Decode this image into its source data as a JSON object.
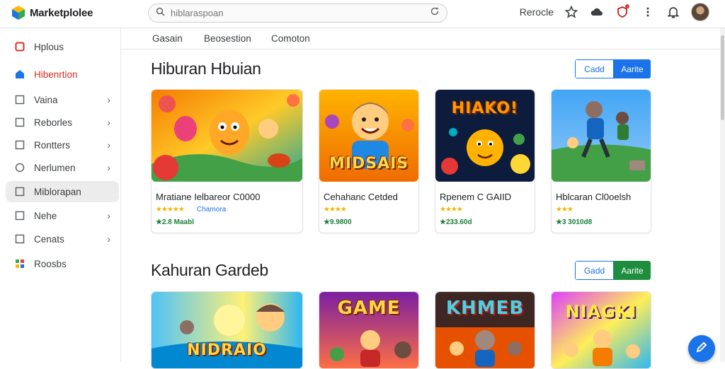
{
  "app": {
    "name": "Marketplolee"
  },
  "search": {
    "placeholder": "hiblaraspoan"
  },
  "header": {
    "link": "Rerocle",
    "icons": [
      "star-icon",
      "cloud-icon",
      "shield-icon",
      "more-icon",
      "bell-icon",
      "avatar"
    ]
  },
  "sidebar": {
    "items": [
      {
        "label": "Hplous",
        "icon": "box-icon",
        "chevron": false,
        "state": "normal"
      },
      {
        "label": "Hibenrtion",
        "icon": "home-icon",
        "chevron": false,
        "state": "active"
      },
      {
        "label": "Vaina",
        "icon": "square-icon",
        "chevron": true,
        "state": "normal"
      },
      {
        "label": "Reborles",
        "icon": "square-icon",
        "chevron": true,
        "state": "normal"
      },
      {
        "label": "Rontters",
        "icon": "square-icon",
        "chevron": true,
        "state": "normal"
      },
      {
        "label": "Nerlumen",
        "icon": "circle-icon",
        "chevron": true,
        "state": "normal"
      },
      {
        "label": "Miblorapan",
        "icon": "square-icon",
        "chevron": false,
        "state": "selected"
      },
      {
        "label": "Nehe",
        "icon": "square-icon",
        "chevron": true,
        "state": "normal"
      },
      {
        "label": "Cenats",
        "icon": "square-icon",
        "chevron": true,
        "state": "normal"
      },
      {
        "label": "Roosbs",
        "icon": "grid-icon",
        "chevron": false,
        "state": "normal"
      }
    ]
  },
  "tabs": [
    "Gasain",
    "Beosestion",
    "Comoton"
  ],
  "sections": [
    {
      "title": "Hiburan Hbuian",
      "btn_left": "Cadd",
      "btn_right": "Aarite",
      "btn_color": "#1a73e8",
      "cards": [
        {
          "title": "Mratiane Ielbareor C0000",
          "stars": "★★★★★",
          "sub": "Chamora",
          "price": "★2.8 Maabl",
          "thumb_text": ""
        },
        {
          "title": "Cehahanc Cetded",
          "stars": "★★★★",
          "sub": "",
          "price": "★9.9800",
          "thumb_text": "MIDSAIS"
        },
        {
          "title": "Rpenem C GAIID",
          "stars": "★★★★",
          "sub": "",
          "price": "★233.60d",
          "thumb_text": "HIAKO!"
        },
        {
          "title": "Hblcaran Cl0oelsh",
          "stars": "★★★",
          "sub": "",
          "price": "★3 3010d8",
          "thumb_text": ""
        }
      ]
    },
    {
      "title": "Kahuran Gardeb",
      "btn_left": "Gadd",
      "btn_right": "Aarite",
      "btn_color": "#1e8e3e",
      "cards": [
        {
          "thumb_text": "NIDRAIO"
        },
        {
          "thumb_text": "GAME"
        },
        {
          "thumb_text": "KHMEB"
        },
        {
          "thumb_text": "NIAGKI"
        }
      ]
    }
  ],
  "colors": {
    "accent": "#1a73e8",
    "active_red": "#d93025",
    "green": "#1e8e3e"
  }
}
